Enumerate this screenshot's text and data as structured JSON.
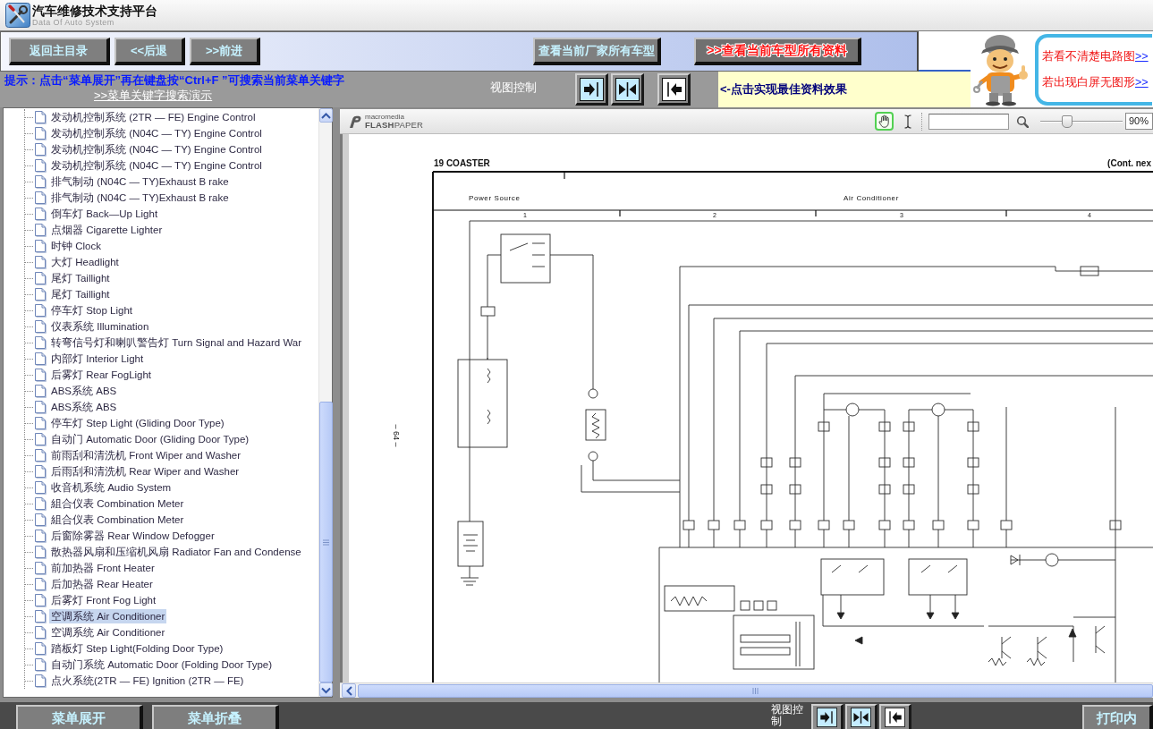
{
  "app": {
    "title": "汽车维修技术支持平台",
    "subtitle": "Data Of Auto System"
  },
  "nav_buttons": [
    {
      "label": "返回主目录"
    },
    {
      "label": "<<后退"
    },
    {
      "label": ">>前进"
    }
  ],
  "model_buttons": [
    {
      "label": "查看当前厂家所有车型",
      "kind": "plain"
    },
    {
      "label": ">>查看当前车型所有资料",
      "kind": "highlight"
    }
  ],
  "hint": {
    "text": "提示：点击“菜单展开”再在键盘按“Ctrl+F ”可搜索当前菜单关键字",
    "link": ">>菜单关键字搜索演示"
  },
  "view_control": {
    "label": "视图控制",
    "buttons": [
      {
        "kind": "expand-right"
      },
      {
        "kind": "split"
      },
      {
        "kind": "expand-left"
      }
    ],
    "tip": "<-点击实现最佳资料效果"
  },
  "help_box": {
    "lines": [
      {
        "text": "若看不清楚电路图",
        "link": ">>"
      },
      {
        "text": "若出现白屏无图形",
        "link": ">>"
      }
    ]
  },
  "tree": {
    "items": [
      {
        "label": "发动机控制系统 (2TR — FE) Engine Control",
        "selected": false
      },
      {
        "label": "发动机控制系统 (N04C — TY) Engine Control",
        "selected": false
      },
      {
        "label": "发动机控制系统 (N04C — TY) Engine Control",
        "selected": false
      },
      {
        "label": "发动机控制系统 (N04C — TY) Engine Control",
        "selected": false
      },
      {
        "label": "排气制动 (N04C — TY)Exhaust B rake",
        "selected": false
      },
      {
        "label": "排气制动 (N04C — TY)Exhaust B rake",
        "selected": false
      },
      {
        "label": "倒车灯 Back—Up Light",
        "selected": false
      },
      {
        "label": "点烟器 Cigarette Lighter",
        "selected": false
      },
      {
        "label": "时钟 Clock",
        "selected": false
      },
      {
        "label": "大灯 Headlight",
        "selected": false
      },
      {
        "label": "尾灯 Taillight",
        "selected": false
      },
      {
        "label": "尾灯 Taillight",
        "selected": false
      },
      {
        "label": "停车灯 Stop Light",
        "selected": false
      },
      {
        "label": "仪表系统 Illumination",
        "selected": false
      },
      {
        "label": "转弯信号灯和喇叭警告灯 Turn Signal and Hazard War",
        "selected": false
      },
      {
        "label": "内部灯 Interior Light",
        "selected": false
      },
      {
        "label": "后雾灯 Rear FogLight",
        "selected": false
      },
      {
        "label": "ABS系统 ABS",
        "selected": false
      },
      {
        "label": "ABS系统 ABS",
        "selected": false
      },
      {
        "label": "停车灯 Step Light (Gliding Door Type)",
        "selected": false
      },
      {
        "label": "自动门 Automatic Door (Gliding Door Type)",
        "selected": false
      },
      {
        "label": "前雨刮和清洗机 Front Wiper and Washer",
        "selected": false
      },
      {
        "label": "后雨刮和清洗机 Rear Wiper and Washer",
        "selected": false
      },
      {
        "label": "收音机系统 Audio System",
        "selected": false
      },
      {
        "label": "組合仪表 Combination Meter",
        "selected": false
      },
      {
        "label": "組合仪表 Combination Meter",
        "selected": false
      },
      {
        "label": "后窗除雾器 Rear Window Defogger",
        "selected": false
      },
      {
        "label": "散热器风扇和压缩机风扇 Radiator Fan and Condense",
        "selected": false
      },
      {
        "label": "前加热器 Front Heater",
        "selected": false
      },
      {
        "label": "后加热器 Rear Heater",
        "selected": false
      },
      {
        "label": "后雾灯 Front Fog Light",
        "selected": false
      },
      {
        "label": "空调系统 Air Conditioner",
        "selected": true
      },
      {
        "label": "空调系统 Air Conditioner",
        "selected": false
      },
      {
        "label": "踏板灯 Step Light(Folding Door Type)",
        "selected": false
      },
      {
        "label": "自动门系统 Automatic Door (Folding Door Type)",
        "selected": false
      },
      {
        "label": "点火系统(2TR — FE) Ignition (2TR — FE)",
        "selected": false
      }
    ]
  },
  "viewer": {
    "logo": {
      "top": "macromedia",
      "bottom": "**FLASH**PAPER"
    },
    "tools": [
      {
        "kind": "hand",
        "selected": true
      },
      {
        "kind": "text-select",
        "selected": false
      }
    ],
    "zoom": {
      "level": 0.3,
      "value": "90%"
    }
  },
  "document": {
    "title": "19 COASTER",
    "continued": "(Cont. nex",
    "sections": [
      "Power Source",
      "Air Conditioner"
    ],
    "columns": [
      "1",
      "2",
      "3",
      "4"
    ],
    "page_number": "– 64 –"
  },
  "bottom_bar": {
    "buttons": [
      {
        "label": "菜单展开"
      },
      {
        "label": "菜单折叠"
      }
    ],
    "view_control": {
      "label": "视图控制",
      "buttons": [
        {
          "kind": "expand-right"
        },
        {
          "kind": "split"
        },
        {
          "kind": "expand-left"
        }
      ]
    },
    "print_button": "打印内"
  }
}
